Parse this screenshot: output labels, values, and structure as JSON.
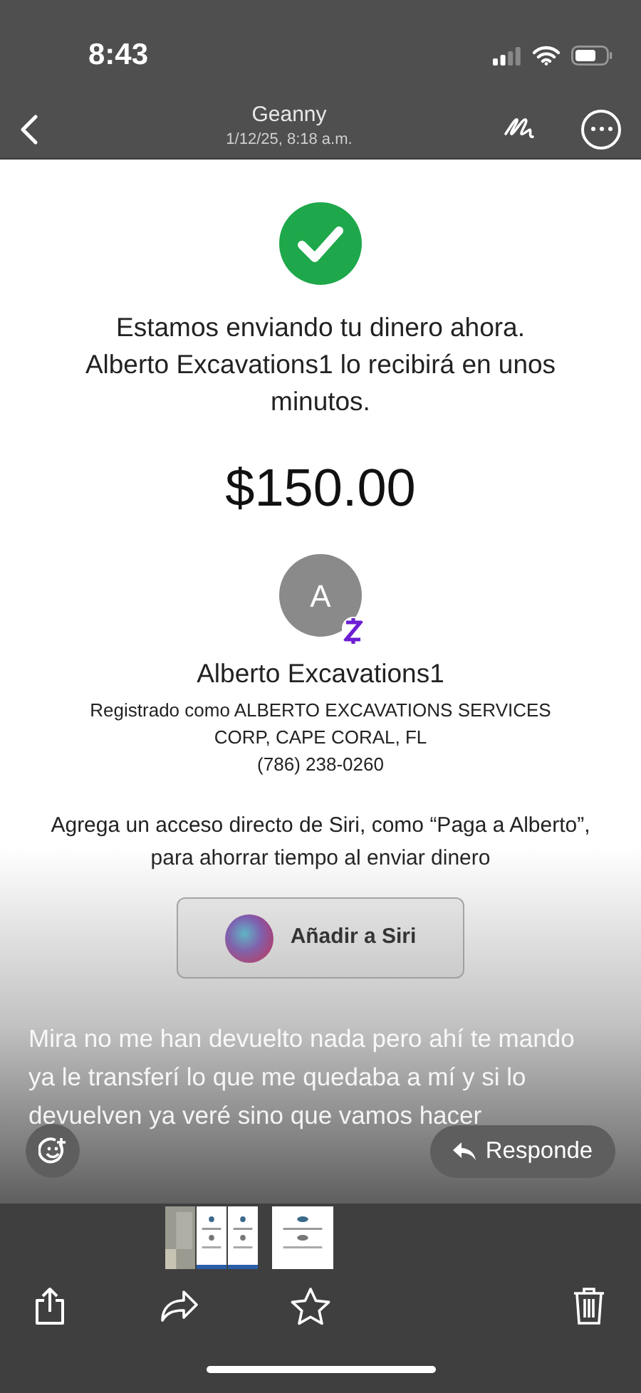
{
  "status_bar": {
    "time": "8:43"
  },
  "nav": {
    "title": "Geanny",
    "subtitle": "1/12/25, 8:18 a.m."
  },
  "receipt": {
    "message": "Estamos enviando tu dinero ahora. Alberto Excavations1 lo recibirá en unos minutos.",
    "amount": "$150.00",
    "avatar_initial": "A",
    "recipient": "Alberto Excavations1",
    "registered": "Registrado como ALBERTO EXCAVATIONS SERVICES CORP, CAPE CORAL, FL",
    "phone": "(786) 238-0260",
    "siri_hint": "Agrega un acceso directo de Siri, como “Paga a Alberto”, para ahorrar tiempo al enviar dinero",
    "siri_button": "Añadir a Siri"
  },
  "caption": "Mira no me han devuelto nada pero ahí te mando ya le transferí lo que me quedaba a mí y si lo devuelven ya veré sino que vamos hacer",
  "reply_button": "Responde",
  "thumbnails": [
    {
      "selected": false
    },
    {
      "selected": false
    },
    {
      "selected": false
    },
    {
      "selected": true
    }
  ]
}
